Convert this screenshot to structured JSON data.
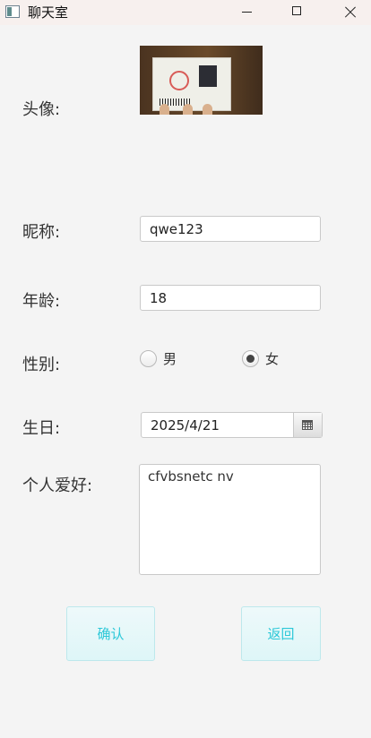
{
  "window": {
    "title": "聊天室"
  },
  "form": {
    "avatar_label": "头像:",
    "nickname_label": "昵称:",
    "nickname_value": "qwe123",
    "age_label": "年龄:",
    "age_value": "18",
    "gender_label": "性别:",
    "gender_options": [
      {
        "label": "男",
        "selected": false
      },
      {
        "label": "女",
        "selected": true
      }
    ],
    "birthday_label": "生日:",
    "birthday_value": "2025/4/21",
    "hobbies_label": "个人爱好:",
    "hobbies_value": "cfvbsnetc nv"
  },
  "buttons": {
    "confirm": "确认",
    "back": "返回"
  },
  "icons": {
    "window_app": "window-app-icon",
    "minimize": "minimize-icon",
    "maximize": "maximize-icon",
    "close": "close-icon",
    "calendar": "calendar-icon"
  },
  "colors": {
    "button_text": "#2cc8d8",
    "button_background": "#e8f8fa",
    "window_background": "#f4f4f4"
  }
}
